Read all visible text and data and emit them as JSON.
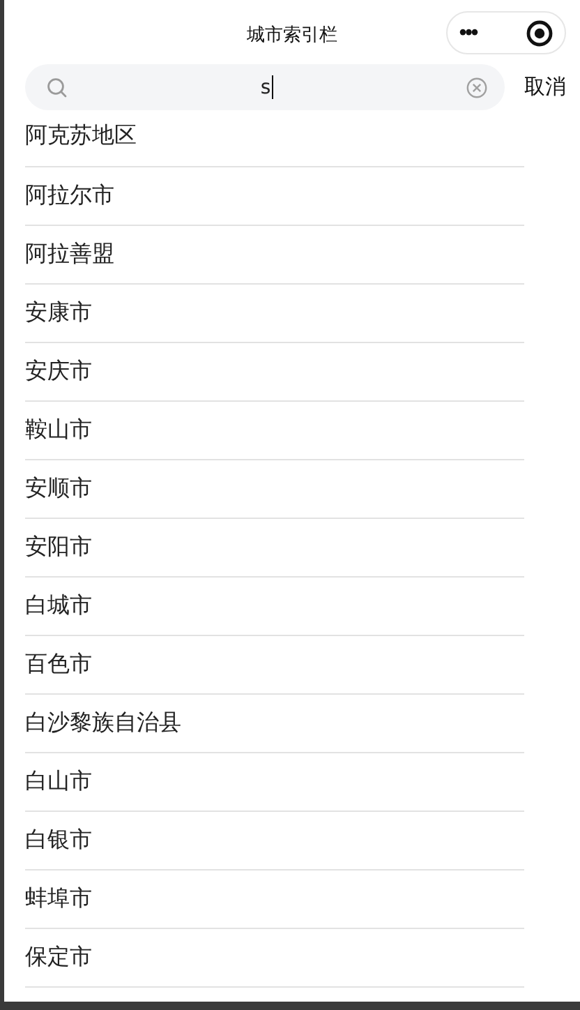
{
  "nav_bar": {
    "title": "城市索引栏",
    "more_button": "•••"
  },
  "search": {
    "value": "s",
    "cancel": "取消"
  },
  "cities": [
    "阿克苏地区",
    "阿拉尔市",
    "阿拉善盟",
    "安康市",
    "安庆市",
    "鞍山市",
    "安顺市",
    "安阳市",
    "白城市",
    "百色市",
    "白沙黎族自治县",
    "白山市",
    "白银市",
    "蚌埠市",
    "保定市"
  ]
}
